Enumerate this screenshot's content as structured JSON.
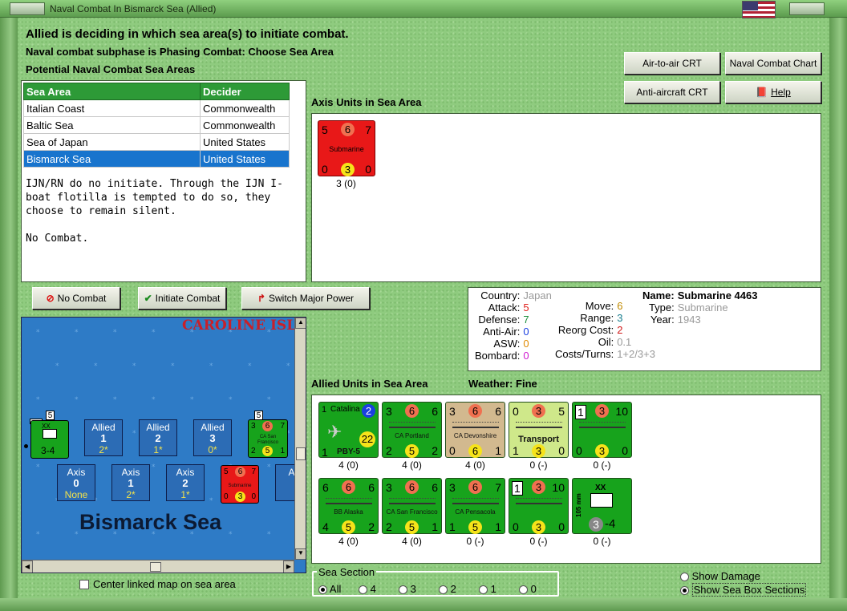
{
  "window": {
    "title": "Naval Combat In Bismarck Sea (Allied)"
  },
  "header": {
    "line1": "Allied is deciding in which sea area(s) to initiate combat.",
    "line2": "Naval combat subphase is Phasing Combat: Choose Sea Area",
    "line3": "Potential Naval Combat Sea Areas"
  },
  "buttons": {
    "air_crt": "Air-to-air CRT",
    "naval_chart": "Naval Combat Chart",
    "aa_crt": "Anti-aircraft CRT",
    "help": "Help",
    "no_combat": "No Combat",
    "initiate": "Initiate Combat",
    "switch": "Switch Major Power"
  },
  "sea_table": {
    "headers": [
      "Sea Area",
      "Decider"
    ],
    "rows": [
      [
        "Italian Coast",
        "Commonwealth"
      ],
      [
        "Baltic Sea",
        "Commonwealth"
      ],
      [
        "Sea of Japan",
        "United States"
      ],
      [
        "Bismarck Sea",
        "United States"
      ]
    ],
    "selected_index": 3
  },
  "message": {
    "p1": "IJN/RN do no initiate.  Through the IJN I-boat flotilla is tempted to do so, they choose to remain silent.",
    "p2": "No Combat."
  },
  "axis": {
    "label": "Axis Units in Sea Area",
    "unit": {
      "tl": "5",
      "tc": "6",
      "tr": "7",
      "name": "Submarine",
      "bl": "0",
      "bc": "3",
      "br": "0",
      "caption": "3 (0)"
    }
  },
  "info": {
    "country_l": "Country:",
    "country": "Japan",
    "attack_l": "Attack:",
    "attack": "5",
    "defense_l": "Defense:",
    "defense": "7",
    "aa_l": "Anti-Air:",
    "aa": "0",
    "asw_l": "ASW:",
    "asw": "0",
    "bombard_l": "Bombard:",
    "bombard": "0",
    "move_l": "Move:",
    "move": "6",
    "range_l": "Range:",
    "range": "3",
    "reorg_l": "Reorg Cost:",
    "reorg": "2",
    "oil_l": "Oil:",
    "oil": "0.1",
    "costs_l": "Costs/Turns:",
    "costs": "1+2/3+3",
    "name_l": "Name:",
    "name": "Submarine 4463",
    "type_l": "Type:",
    "type": "Submarine",
    "year_l": "Year:",
    "year": "1943"
  },
  "allied": {
    "label": "Allied Units in Sea Area",
    "weather_l": "Weather:",
    "weather": "Fine",
    "units": [
      {
        "kind": "air",
        "tl": "1",
        "name_top": "Catalina",
        "tr": "2",
        "br": "22",
        "name": "PBY-5",
        "bl": "1",
        "caption": "4 (0)"
      },
      {
        "kind": "ship",
        "tl": "3",
        "tc": "6",
        "tr": "6",
        "name": "CA Portland",
        "bl": "2",
        "bc": "5",
        "br": "2",
        "caption": "4 (0)"
      },
      {
        "kind": "ship",
        "tl": "3",
        "tc": "6",
        "tr": "6",
        "name": "CA Devonshire",
        "bl": "0",
        "bc": "6",
        "br": "1",
        "caption": "4 (0)"
      },
      {
        "kind": "transport",
        "tl": "0",
        "tc": "3",
        "tr": "5",
        "name": "Transport",
        "bl": "1",
        "bc": "3",
        "br": "0",
        "caption": "0 (-)"
      },
      {
        "kind": "ship",
        "tl": "1",
        "tc": "3",
        "tr": "10",
        "name": "",
        "bl": "0",
        "bc": "3",
        "br": "0",
        "caption": "0 (-)"
      },
      {
        "kind": "ship",
        "tl": "6",
        "tc": "6",
        "tr": "6",
        "name": "BB Alaska",
        "bl": "4",
        "bc": "5",
        "br": "2",
        "caption": "4 (0)"
      },
      {
        "kind": "ship",
        "tl": "3",
        "tc": "6",
        "tr": "6",
        "name": "CA San Francisco",
        "bl": "2",
        "bc": "5",
        "br": "1",
        "caption": "4 (0)"
      },
      {
        "kind": "ship",
        "tl": "3",
        "tc": "6",
        "tr": "7",
        "name": "CA Pensacola",
        "bl": "1",
        "bc": "5",
        "br": "1",
        "caption": "0 (-)"
      },
      {
        "kind": "ship",
        "tl": "1",
        "tc": "3",
        "tr": "10",
        "name": "",
        "bl": "0",
        "bc": "3",
        "br": "0",
        "caption": "0 (-)"
      },
      {
        "kind": "land",
        "tl": "XX",
        "name": "105 mm",
        "bl": "3",
        "br": "-4",
        "caption": "0 (-)"
      }
    ]
  },
  "map": {
    "region": "CAROLINE ISL",
    "sea": "Bismarck Sea",
    "allied_boxes": [
      {
        "t": "Allied",
        "n": "1",
        "v": "2*"
      },
      {
        "t": "Allied",
        "n": "2",
        "v": "1*"
      },
      {
        "t": "Allied",
        "n": "3",
        "v": "0*"
      }
    ],
    "axis_boxes": [
      {
        "t": "Axis",
        "n": "0",
        "v": "None"
      },
      {
        "t": "Axis",
        "n": "1",
        "v": "2*"
      },
      {
        "t": "Axis",
        "n": "2",
        "v": "1*"
      },
      {
        "t": "A"
      }
    ],
    "stack_a": "5",
    "stack_b": "5",
    "unit_a": {
      "top": "XX",
      "bot": "3-4",
      "side": "105 mm"
    },
    "unit_b": {
      "tl": "3",
      "tc": "6",
      "tr": "7",
      "name": "CA San Francisco",
      "bl": "2",
      "bc": "5",
      "br": "1"
    },
    "unit_c": {
      "tl": "5",
      "tc": "6",
      "tr": "7",
      "name": "Submarine",
      "bl": "0",
      "bc": "3",
      "br": "0"
    }
  },
  "center_map": "Center linked map on sea area",
  "sea_section": {
    "label": "Sea Section",
    "options": [
      "All",
      "4",
      "3",
      "2",
      "1",
      "0"
    ],
    "selected": "All"
  },
  "options": {
    "damage": "Show Damage",
    "boxes": "Show Sea Box Sections",
    "selected": "boxes"
  }
}
